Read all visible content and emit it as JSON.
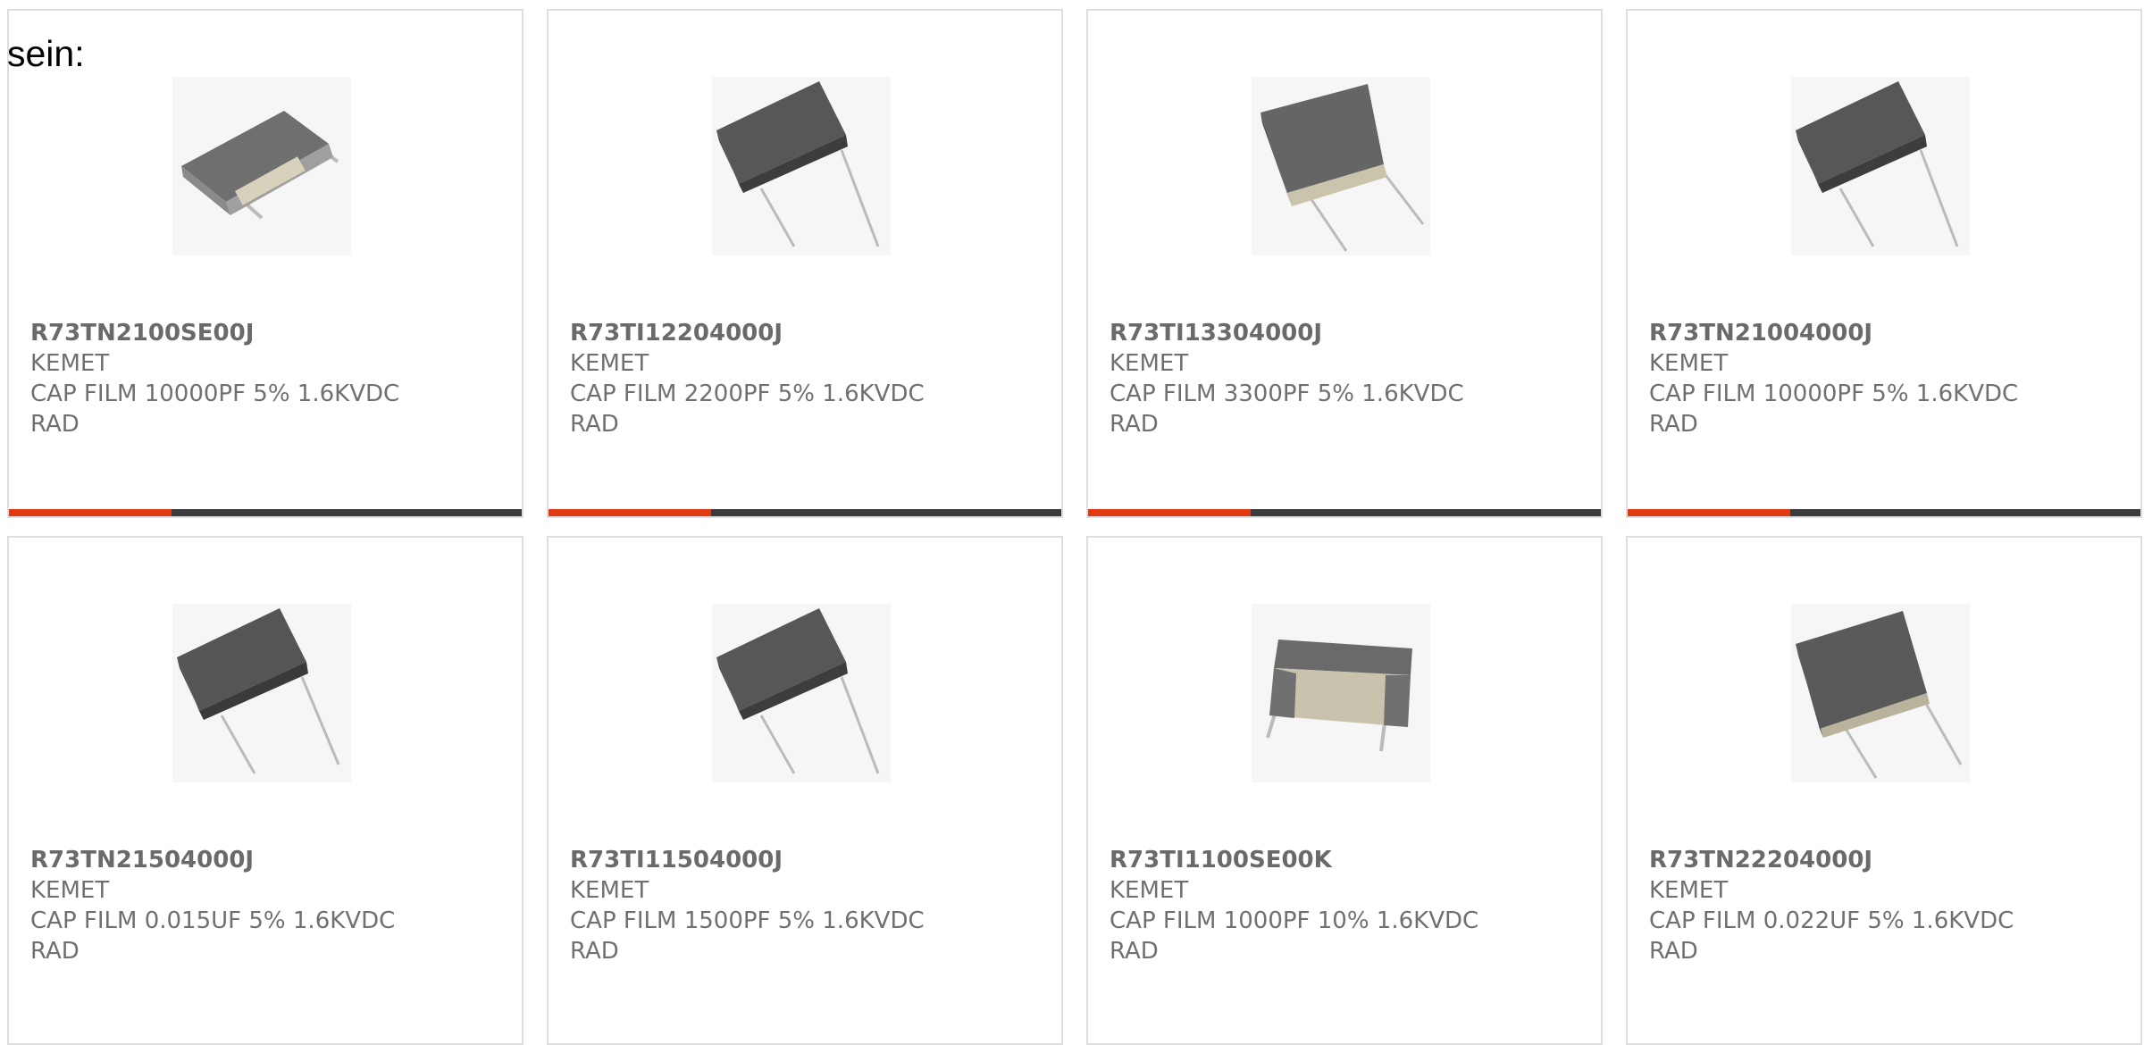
{
  "intro_text": "sein:",
  "colors": {
    "accent": "#e03a12",
    "bar": "#3b3b3b",
    "border": "#dddddd",
    "text": "#707070"
  },
  "products": [
    {
      "part": "R73TN2100SE00J",
      "maker": "KEMET",
      "desc": "CAP FILM 10000PF 5% 1.6KVDC",
      "desc2": "RAD",
      "image_icon": "capacitor-image"
    },
    {
      "part": "R73TI12204000J",
      "maker": "KEMET",
      "desc": "CAP FILM 2200PF 5% 1.6KVDC",
      "desc2": "RAD",
      "image_icon": "capacitor-image"
    },
    {
      "part": "R73TI13304000J",
      "maker": "KEMET",
      "desc": "CAP FILM 3300PF 5% 1.6KVDC",
      "desc2": "RAD",
      "image_icon": "capacitor-image"
    },
    {
      "part": "R73TN21004000J",
      "maker": "KEMET",
      "desc": "CAP FILM 10000PF 5% 1.6KVDC",
      "desc2": "RAD",
      "image_icon": "capacitor-image"
    },
    {
      "part": "R73TN21504000J",
      "maker": "KEMET",
      "desc": "CAP FILM 0.015UF 5% 1.6KVDC",
      "desc2": "RAD",
      "image_icon": "capacitor-image"
    },
    {
      "part": "R73TI11504000J",
      "maker": "KEMET",
      "desc": "CAP FILM 1500PF 5% 1.6KVDC",
      "desc2": "RAD",
      "image_icon": "capacitor-image"
    },
    {
      "part": "R73TI1100SE00K",
      "maker": "KEMET",
      "desc": "CAP FILM 1000PF 10% 1.6KVDC",
      "desc2": "RAD",
      "image_icon": "capacitor-image"
    },
    {
      "part": "R73TN22204000J",
      "maker": "KEMET",
      "desc": "CAP FILM 0.022UF 5% 1.6KVDC",
      "desc2": "RAD",
      "image_icon": "capacitor-image"
    }
  ]
}
